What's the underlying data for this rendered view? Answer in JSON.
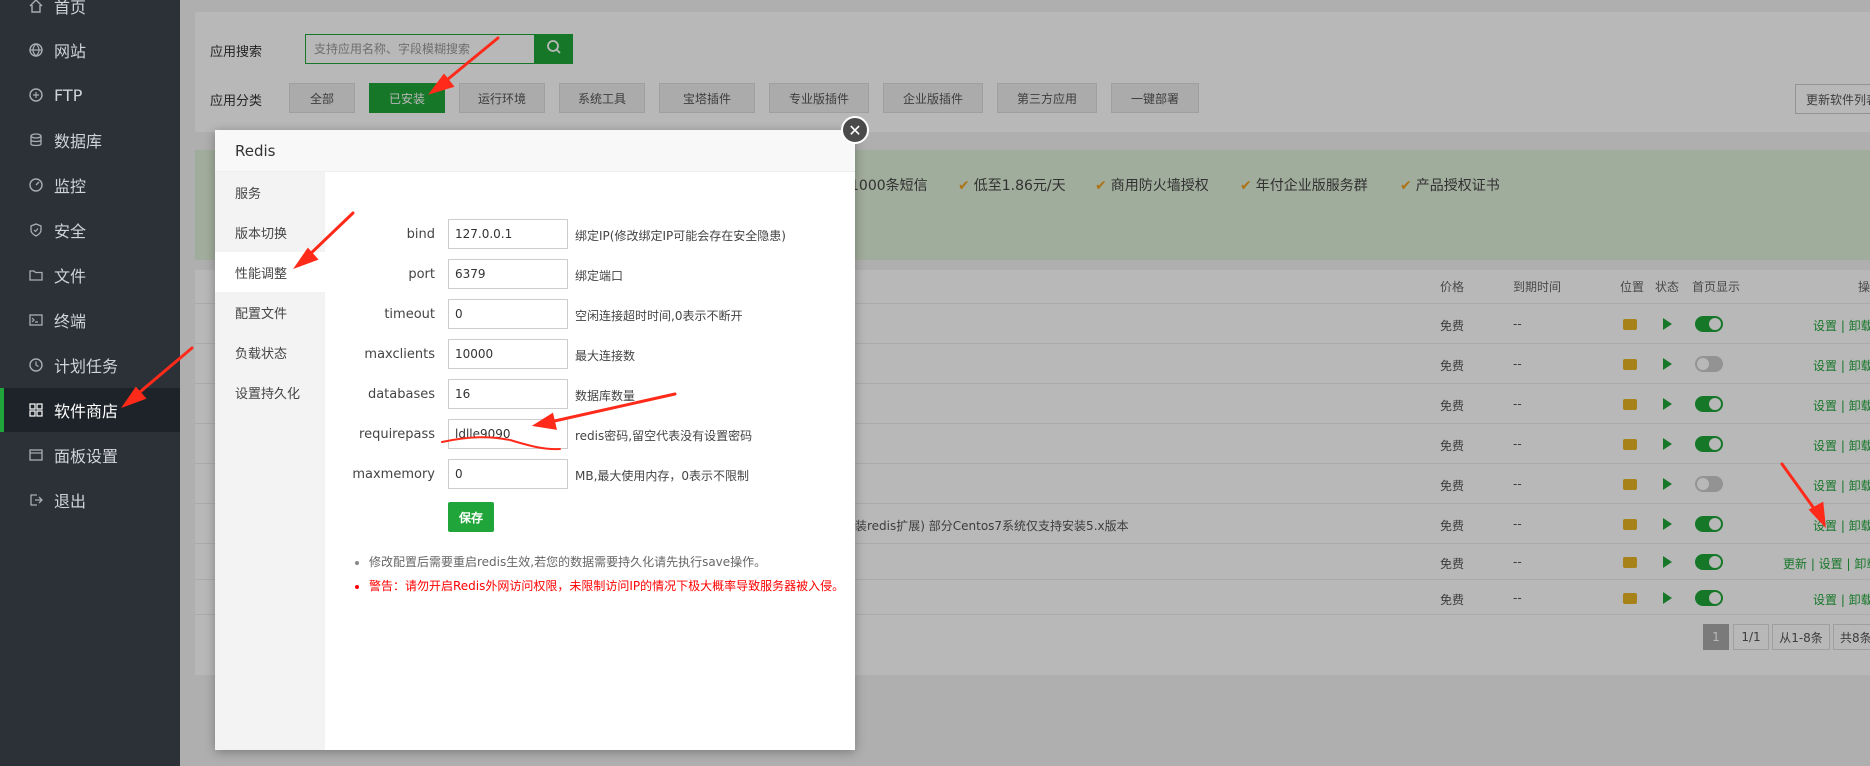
{
  "sidebar": {
    "items": [
      {
        "label": "首页",
        "icon": "home-icon"
      },
      {
        "label": "网站",
        "icon": "globe-icon"
      },
      {
        "label": "FTP",
        "icon": "ftp-icon"
      },
      {
        "label": "数据库",
        "icon": "database-icon"
      },
      {
        "label": "监控",
        "icon": "monitor-icon"
      },
      {
        "label": "安全",
        "icon": "shield-icon"
      },
      {
        "label": "文件",
        "icon": "folder-icon"
      },
      {
        "label": "终端",
        "icon": "terminal-icon"
      },
      {
        "label": "计划任务",
        "icon": "clock-icon"
      },
      {
        "label": "软件商店",
        "icon": "grid-icon",
        "active": true
      },
      {
        "label": "面板设置",
        "icon": "settings-icon"
      },
      {
        "label": "退出",
        "icon": "logout-icon"
      }
    ]
  },
  "toolbar": {
    "search_label": "应用搜索",
    "search_placeholder": "支持应用名称、字段模糊搜索",
    "category_label": "应用分类",
    "categories": [
      "全部",
      "已安装",
      "运行环境",
      "系统工具",
      "宝塔插件",
      "专业版插件",
      "企业版插件",
      "第三方应用",
      "一键部署"
    ],
    "active_category": "已安装",
    "update_list": "更新软件列表"
  },
  "promo": {
    "items": [
      "1000条短信",
      "低至1.86元/天",
      "商用防火墙授权",
      "年付企业版服务群",
      "产品授权证书"
    ]
  },
  "table": {
    "headers": {
      "price": "价格",
      "expire": "到期时间",
      "location": "位置",
      "status": "状态",
      "home": "首页显示",
      "ops": "操作"
    },
    "rows": [
      {
        "price": "免费",
        "expire": "--",
        "home_on": true,
        "ops": "设置 | 卸载"
      },
      {
        "price": "免费",
        "expire": "--",
        "home_on": false,
        "ops": "设置 | 卸载"
      },
      {
        "price": "免费",
        "expire": "--",
        "home_on": true,
        "ops": "设置 | 卸载"
      },
      {
        "price": "免费",
        "expire": "--",
        "home_on": true,
        "ops": "设置 | 卸载"
      },
      {
        "price": "免费",
        "expire": "--",
        "home_on": false,
        "ops": "设置 | 卸载"
      },
      {
        "price": "免费",
        "expire": "--",
        "home_on": true,
        "ops": "设置 | 卸载",
        "desc": "装redis扩展) 部分Centos7系统仅支持安装5.x版本"
      },
      {
        "price": "免费",
        "expire": "--",
        "home_on": true,
        "ops": "更新 | 设置 | 卸载"
      },
      {
        "price": "免费",
        "expire": "--",
        "home_on": true,
        "ops": "设置 | 卸载"
      }
    ]
  },
  "pagination": {
    "current": "1",
    "pages": "1/1",
    "range": "从1-8条",
    "total": "共8条"
  },
  "modal": {
    "title": "Redis",
    "tabs": [
      "服务",
      "版本切换",
      "性能调整",
      "配置文件",
      "负载状态",
      "设置持久化"
    ],
    "active_tab": "性能调整",
    "fields": [
      {
        "name": "bind",
        "value": "127.0.0.1",
        "help": "绑定IP(修改绑定IP可能会存在安全隐患)"
      },
      {
        "name": "port",
        "value": "6379",
        "help": "绑定端口"
      },
      {
        "name": "timeout",
        "value": "0",
        "help": "空闲连接超时时间,0表示不断开"
      },
      {
        "name": "maxclients",
        "value": "10000",
        "help": "最大连接数"
      },
      {
        "name": "databases",
        "value": "16",
        "help": "数据库数量"
      },
      {
        "name": "requirepass",
        "value": "ldlle9090",
        "help": "redis密码,留空代表没有设置密码"
      },
      {
        "name": "maxmemory",
        "value": "0",
        "help": "MB,最大使用内存，0表示不限制"
      }
    ],
    "save_label": "保存",
    "notes": [
      {
        "text": "修改配置后需要重启redis生效,若您的数据需要持久化请先执行save操作。",
        "color": "#666666"
      },
      {
        "text": "警告：请勿开启Redis外网访问权限，未限制访问IP的情况下极大概率导致服务器被入侵。",
        "color": "#ff0000"
      }
    ]
  },
  "colors": {
    "accent": "#20a53a",
    "annotation": "#ff2a1a",
    "sidebar_bg": "#2c3138"
  }
}
